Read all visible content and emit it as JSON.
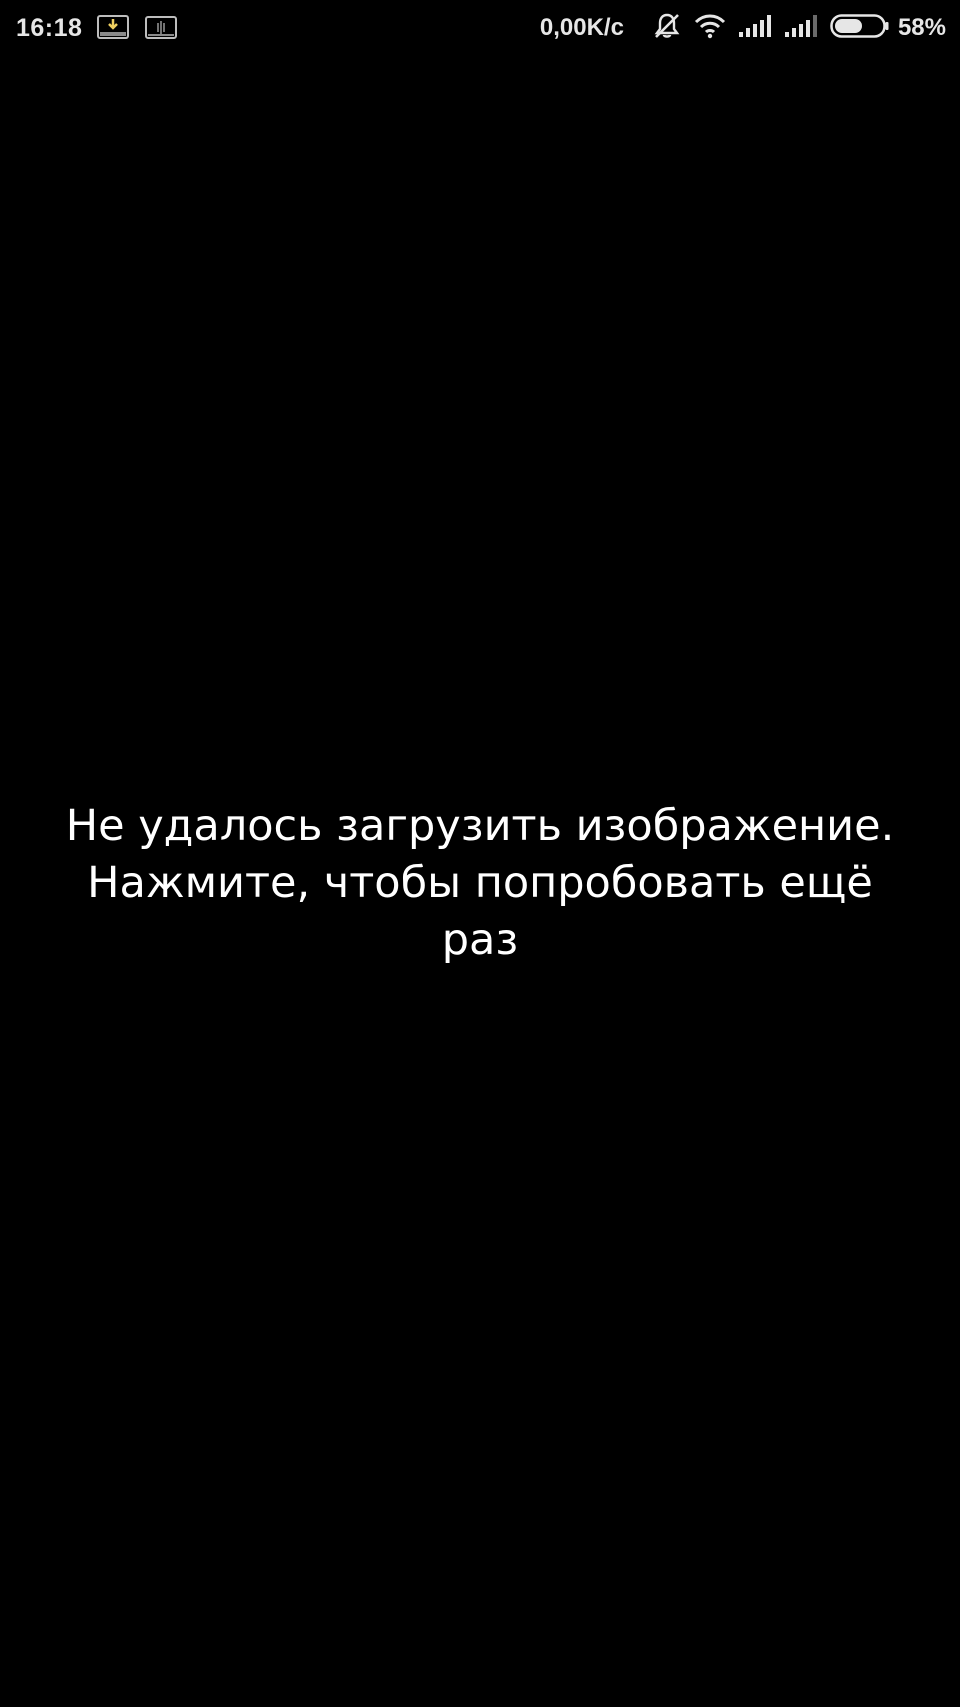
{
  "status_bar": {
    "time": "16:18",
    "net_speed": "0,00K/c",
    "battery_percent": "58%",
    "battery_level": 0.58,
    "icons": [
      "download-notification-icon",
      "screen-notification-icon",
      "mute-icon",
      "wifi-icon",
      "signal-sim1-icon",
      "signal-sim2-icon",
      "battery-icon"
    ]
  },
  "main": {
    "error_lines": [
      "Не удалось загрузить изображение.",
      "Нажмите, чтобы попробовать ещё",
      "раз"
    ]
  },
  "colors": {
    "background": "#000000",
    "text": "#ffffff",
    "status_text": "#e6e6e6"
  }
}
